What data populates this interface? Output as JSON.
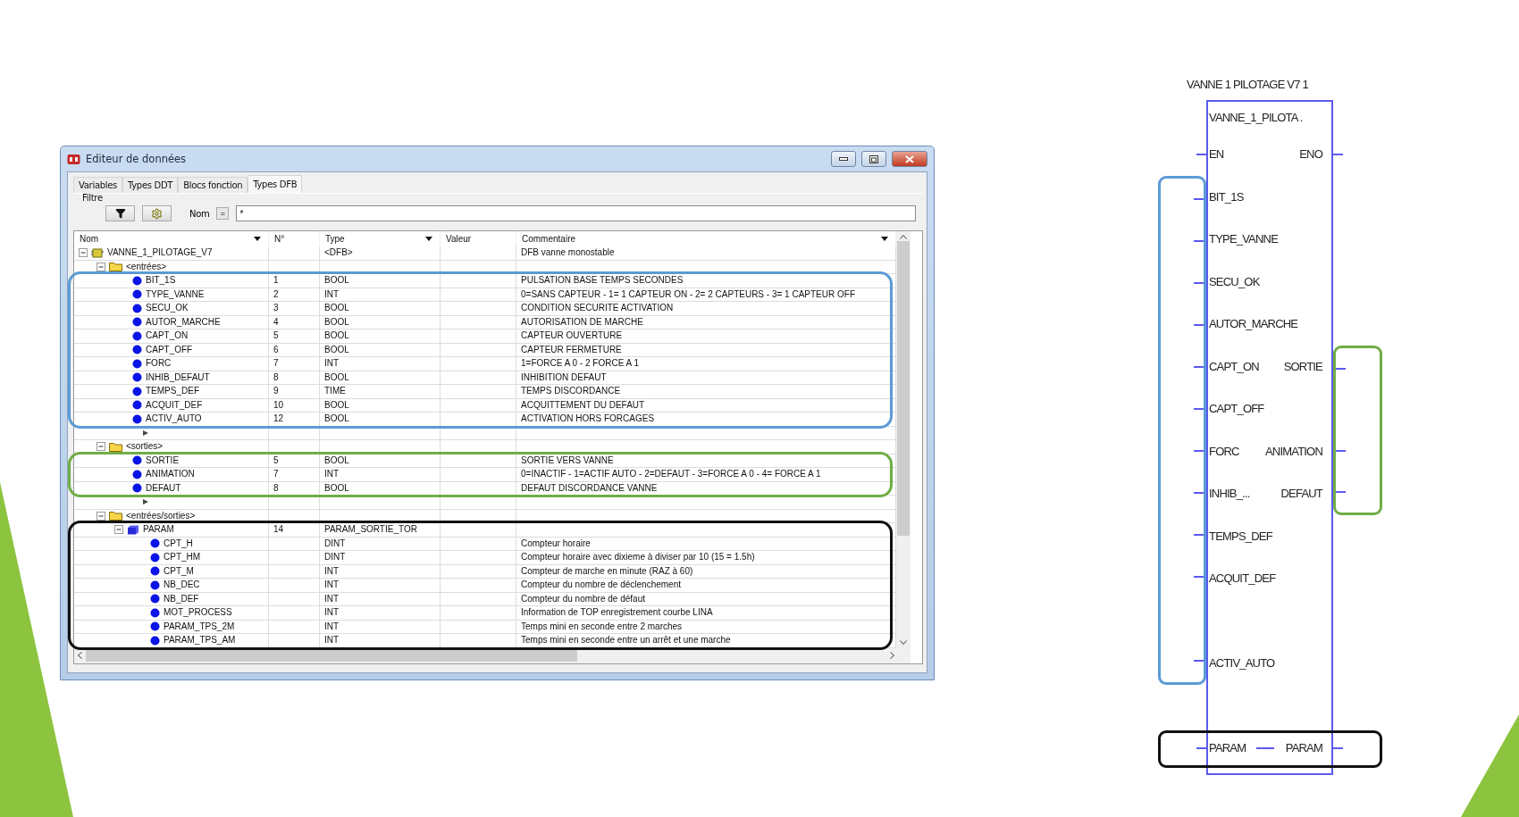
{
  "window": {
    "title": "Editeur de données"
  },
  "tabs": [
    {
      "label": "Variables",
      "selected": false
    },
    {
      "label": "Types DDT",
      "selected": false
    },
    {
      "label": "Blocs fonction",
      "selected": false
    },
    {
      "label": "Types DFB",
      "selected": true
    }
  ],
  "filter": {
    "legend": "Filtre",
    "name_label": "Nom",
    "operator": "=",
    "value": "*"
  },
  "columns": [
    {
      "label": "Nom",
      "dropdown": true
    },
    {
      "label": "N°",
      "dropdown": false
    },
    {
      "label": "Type",
      "dropdown": true
    },
    {
      "label": "Valeur",
      "dropdown": false
    },
    {
      "label": "Commentaire",
      "dropdown": true
    }
  ],
  "tree": {
    "kind": "dfb",
    "name": "VANNE_1_PILOTAGE_V7",
    "type": "<DFB>",
    "comment": "DFB vanne monostable",
    "expanded": true,
    "children": [
      {
        "kind": "folder",
        "name": "<entrées>",
        "expanded": true,
        "color": "#5b9bd5",
        "children": [
          {
            "kind": "var",
            "name": "BIT_1S",
            "number": "1",
            "type": "BOOL",
            "comment": "PULSATION BASE TEMPS SECONDES"
          },
          {
            "kind": "var",
            "name": "TYPE_VANNE",
            "number": "2",
            "type": "INT",
            "comment": "0=SANS CAPTEUR - 1= 1 CAPTEUR ON - 2= 2 CAPTEURS - 3= 1 CAPTEUR OFF"
          },
          {
            "kind": "var",
            "name": "SECU_OK",
            "number": "3",
            "type": "BOOL",
            "comment": "CONDITION SECURITE ACTIVATION"
          },
          {
            "kind": "var",
            "name": "AUTOR_MARCHE",
            "number": "4",
            "type": "BOOL",
            "comment": "AUTORISATION DE MARCHE"
          },
          {
            "kind": "var",
            "name": "CAPT_ON",
            "number": "5",
            "type": "BOOL",
            "comment": "CAPTEUR OUVERTURE"
          },
          {
            "kind": "var",
            "name": "CAPT_OFF",
            "number": "6",
            "type": "BOOL",
            "comment": "CAPTEUR FERMETURE"
          },
          {
            "kind": "var",
            "name": "FORC",
            "number": "7",
            "type": "INT",
            "comment": "1=FORCE A 0 - 2 FORCE A 1"
          },
          {
            "kind": "var",
            "name": "INHIB_DEFAUT",
            "number": "8",
            "type": "BOOL",
            "comment": "INHIBITION DEFAUT"
          },
          {
            "kind": "var",
            "name": "TEMPS_DEF",
            "number": "9",
            "type": "TIME",
            "comment": "TEMPS DISCORDANCE"
          },
          {
            "kind": "var",
            "name": "ACQUIT_DEF",
            "number": "10",
            "type": "BOOL",
            "comment": "ACQUITTEMENT DU DEFAUT"
          },
          {
            "kind": "var",
            "name": "ACTIV_AUTO",
            "number": "12",
            "type": "BOOL",
            "comment": "ACTIVATION HORS FORCAGES"
          }
        ]
      },
      {
        "kind": "add"
      },
      {
        "kind": "folder",
        "name": "<sorties>",
        "expanded": true,
        "color": "#70ad47",
        "children": [
          {
            "kind": "var",
            "name": "SORTIE",
            "number": "5",
            "type": "BOOL",
            "comment": "SORTIE VERS VANNE"
          },
          {
            "kind": "var",
            "name": "ANIMATION",
            "number": "7",
            "type": "INT",
            "comment": "0=INACTIF - 1=ACTIF AUTO - 2=DEFAUT - 3=FORCE A 0 - 4= FORCE A 1"
          },
          {
            "kind": "var",
            "name": "DEFAUT",
            "number": "8",
            "type": "BOOL",
            "comment": "DEFAUT DISCORDANCE VANNE"
          }
        ]
      },
      {
        "kind": "add"
      },
      {
        "kind": "folder",
        "name": "<entrées/sorties>",
        "expanded": true,
        "color": "#111111",
        "children": [
          {
            "kind": "struct",
            "name": "PARAM",
            "number": "14",
            "type": "PARAM_SORTIE_TOR",
            "expanded": true,
            "children": [
              {
                "kind": "var",
                "name": "CPT_H",
                "type": "DINT",
                "comment": "Compteur horaire"
              },
              {
                "kind": "var",
                "name": "CPT_HM",
                "type": "DINT",
                "comment": "Compteur horaire avec dixieme à diviser par 10 (15 = 1.5h)"
              },
              {
                "kind": "var",
                "name": "CPT_M",
                "type": "INT",
                "comment": "Compteur de marche en minute (RAZ à 60)"
              },
              {
                "kind": "var",
                "name": "NB_DEC",
                "type": "INT",
                "comment": "Compteur du nombre de déclenchement"
              },
              {
                "kind": "var",
                "name": "NB_DEF",
                "type": "INT",
                "comment": "Compteur du nombre de défaut"
              },
              {
                "kind": "var",
                "name": "MOT_PROCESS",
                "type": "INT",
                "comment": "Information de TOP enregistrement courbe LINA"
              },
              {
                "kind": "var",
                "name": "PARAM_TPS_2M",
                "type": "INT",
                "comment": "Temps mini en seconde entre 2 marches"
              },
              {
                "kind": "var",
                "name": "PARAM_TPS_AM",
                "type": "INT",
                "comment": "Temps mini en seconde entre un arrêt et une marche"
              }
            ]
          }
        ]
      }
    ]
  },
  "block": {
    "instance": "VANNE 1 PILOTAGE V7 1",
    "type_name": "VANNE_1_PILOTA .",
    "inputs": [
      {
        "pins": [
          {
            "kind": "pin",
            "label": "EN"
          }
        ]
      },
      {
        "color": "#5b9bd5",
        "pins": [
          {
            "kind": "pin",
            "label": "BIT_1S"
          },
          {
            "kind": "pin",
            "label": "TYPE_VANNE"
          },
          {
            "kind": "pin",
            "label": "SECU_OK"
          },
          {
            "kind": "pin",
            "label": "AUTOR_MARCHE"
          },
          {
            "kind": "pin",
            "label": "CAPT_ON"
          },
          {
            "kind": "pin",
            "label": "CAPT_OFF"
          },
          {
            "kind": "pin",
            "label": "FORC"
          },
          {
            "kind": "pin",
            "label": "INHIB_..."
          },
          {
            "kind": "pin",
            "label": "TEMPS_DEF"
          },
          {
            "kind": "pin",
            "label": "ACQUIT_DEF"
          },
          {
            "kind": "spacer"
          },
          {
            "kind": "pin",
            "label": "ACTIV_AUTO"
          }
        ]
      },
      {
        "pins": [
          {
            "kind": "spacer"
          }
        ]
      }
    ],
    "outputs": [
      {
        "pins": [
          {
            "kind": "pin",
            "label": "ENO"
          },
          {
            "kind": "spacer"
          },
          {
            "kind": "spacer"
          },
          {
            "kind": "spacer"
          },
          {
            "kind": "spacer"
          }
        ]
      },
      {
        "color": "#70ad47",
        "pins": [
          {
            "kind": "pin",
            "label": "SORTIE"
          },
          {
            "kind": "spacer"
          },
          {
            "kind": "pin",
            "label": "ANIMATION"
          },
          {
            "kind": "pin",
            "label": "DEFAUT"
          }
        ]
      },
      {
        "pins": [
          {
            "kind": "spacer"
          },
          {
            "kind": "spacer"
          },
          {
            "kind": "spacer"
          },
          {
            "kind": "spacer"
          },
          {
            "kind": "spacer"
          }
        ]
      }
    ],
    "inout": {
      "left": "PARAM",
      "right": "PARAM",
      "color": "#111111"
    }
  }
}
